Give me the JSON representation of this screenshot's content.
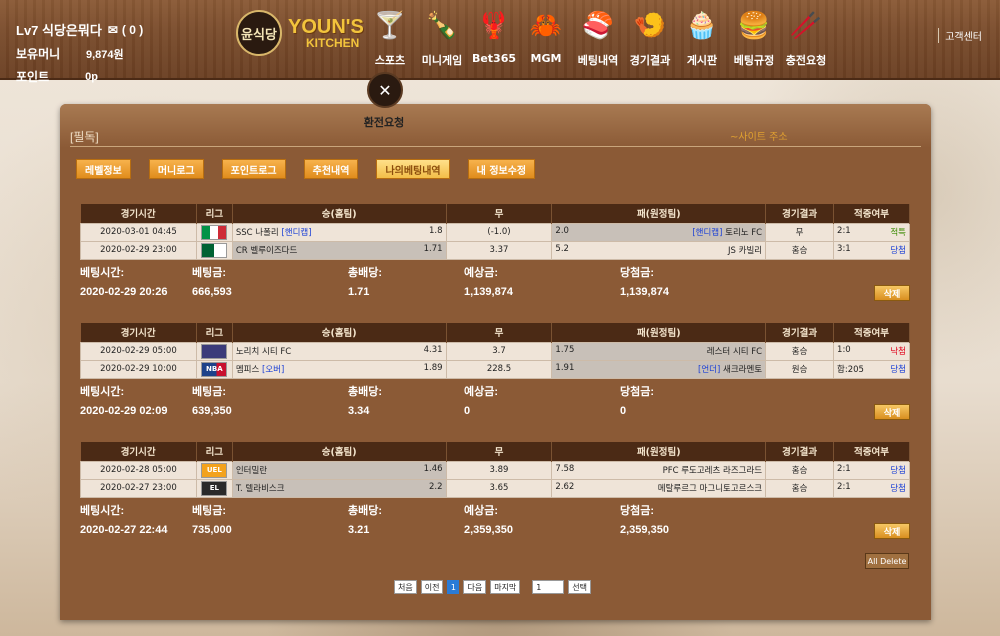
{
  "header": {
    "user_level_name": "Lv7 식당은뭐다",
    "message_count": "( 0 )",
    "money_label": "보유머니",
    "money_value": "9,874원",
    "point_label": "포인트",
    "point_value": "0p",
    "logo_circle": "윤식당",
    "logo_brand": "YOUN'S",
    "logo_sub": "KITCHEN",
    "nav": [
      {
        "label": "스포츠",
        "icon": "cocktail-icon"
      },
      {
        "label": "미니게임",
        "icon": "bottle-icon"
      },
      {
        "label": "Bet365",
        "icon": "lobster-icon"
      },
      {
        "label": "MGM",
        "icon": "crab-icon"
      },
      {
        "label": "베팅내역",
        "icon": "sushi-icon"
      },
      {
        "label": "경기결과",
        "icon": "shrimp-icon"
      },
      {
        "label": "게시판",
        "icon": "cupcake-icon"
      },
      {
        "label": "베팅규정",
        "icon": "burger-icon"
      },
      {
        "label": "충전요청",
        "icon": "chopsticks-icon"
      }
    ],
    "exchange_label": "환전요청",
    "support_label": "고객센터"
  },
  "panel": {
    "title": "[필독]",
    "marquee": "~사이트 주소",
    "tabs": [
      "레벨정보",
      "머니로그",
      "포인트로그",
      "추천내역",
      "나의베팅내역",
      "내 정보수정"
    ],
    "active_tab": 4
  },
  "table_headers": [
    "경기시간",
    "리그",
    "승(홈팀)",
    "무",
    "패(원정팀)",
    "경기결과",
    "적중여부"
  ],
  "summary_labels": {
    "bet_time": "베팅시간:",
    "bet_amount": "베팅금:",
    "total_odds": "총배당:",
    "expected": "예상금:",
    "winnings": "당첨금:"
  },
  "delete_label": "삭제",
  "bets": [
    {
      "rows": [
        {
          "time": "2020-03-01 04:45",
          "league_flag": "italy",
          "home": "SSC 나폴리",
          "home_tag": "[핸디캡]",
          "home_odds": "1.8",
          "draw": "(-1.0)",
          "away_odds": "2.0",
          "away_tag": "[핸디캡]",
          "away": "토리노 FC",
          "result": "무",
          "score": "2:1",
          "status": "적특",
          "status_type": "hit",
          "home_sel": false,
          "away_sel": true
        },
        {
          "time": "2020-02-29 23:00",
          "league_flag": "algeria",
          "home": "CR 벨루이즈다드",
          "home_tag": "",
          "home_odds": "1.71",
          "draw": "3.37",
          "away_odds": "5.2",
          "away_tag": "",
          "away": "JS 카빌리",
          "result": "홈승",
          "score": "3:1",
          "status": "당첨",
          "status_type": "win",
          "home_sel": true,
          "away_sel": false
        }
      ],
      "bet_time": "2020-02-29 20:26",
      "bet_amount": "666,593",
      "total_odds": "1.71",
      "expected": "1,139,874",
      "winnings": "1,139,874"
    },
    {
      "rows": [
        {
          "time": "2020-02-29 05:00",
          "league_flag": "england",
          "home": "노리치 시티 FC",
          "home_tag": "",
          "home_odds": "4.31",
          "draw": "3.7",
          "away_odds": "1.75",
          "away_tag": "",
          "away": "레스터 시티 FC",
          "result": "홈승",
          "score": "1:0",
          "status": "낙첨",
          "status_type": "lose",
          "home_sel": false,
          "away_sel": true
        },
        {
          "time": "2020-02-29 10:00",
          "league_flag": "nba",
          "home": "멤피스",
          "home_tag": "[오버]",
          "home_odds": "1.89",
          "draw": "228.5",
          "away_odds": "1.91",
          "away_tag": "[언더]",
          "away": "새크라멘토",
          "result": "원승",
          "score": "합:205",
          "status": "당첨",
          "status_type": "win",
          "home_sel": false,
          "away_sel": true
        }
      ],
      "bet_time": "2020-02-29 02:09",
      "bet_amount": "639,350",
      "total_odds": "3.34",
      "expected": "0",
      "winnings": "0"
    },
    {
      "rows": [
        {
          "time": "2020-02-28 05:00",
          "league_flag": "europa",
          "home": "인터밀란",
          "home_tag": "",
          "home_odds": "1.46",
          "draw": "3.89",
          "away_odds": "7.58",
          "away_tag": "",
          "away": "PFC 루도고레츠 라즈그라드",
          "result": "홈승",
          "score": "2:1",
          "status": "당첨",
          "status_type": "win",
          "home_sel": true,
          "away_sel": false
        },
        {
          "time": "2020-02-27 23:00",
          "league_flag": "euroleague",
          "home": "T. 텔라비스크",
          "home_tag": "",
          "home_odds": "2.2",
          "draw": "3.65",
          "away_odds": "2.62",
          "away_tag": "",
          "away": "메탈루르그 마그니토고르스크",
          "result": "홈승",
          "score": "2:1",
          "status": "당첨",
          "status_type": "win",
          "home_sel": true,
          "away_sel": false
        }
      ],
      "bet_time": "2020-02-27 22:44",
      "bet_amount": "735,000",
      "total_odds": "3.21",
      "expected": "2,359,350",
      "winnings": "2,359,350"
    }
  ],
  "all_delete_label": "All Delete",
  "pager": {
    "first": "처음",
    "prev": "이전",
    "current": "1",
    "next": "다음",
    "last": "마지막",
    "input_value": "1",
    "go": "선택"
  }
}
